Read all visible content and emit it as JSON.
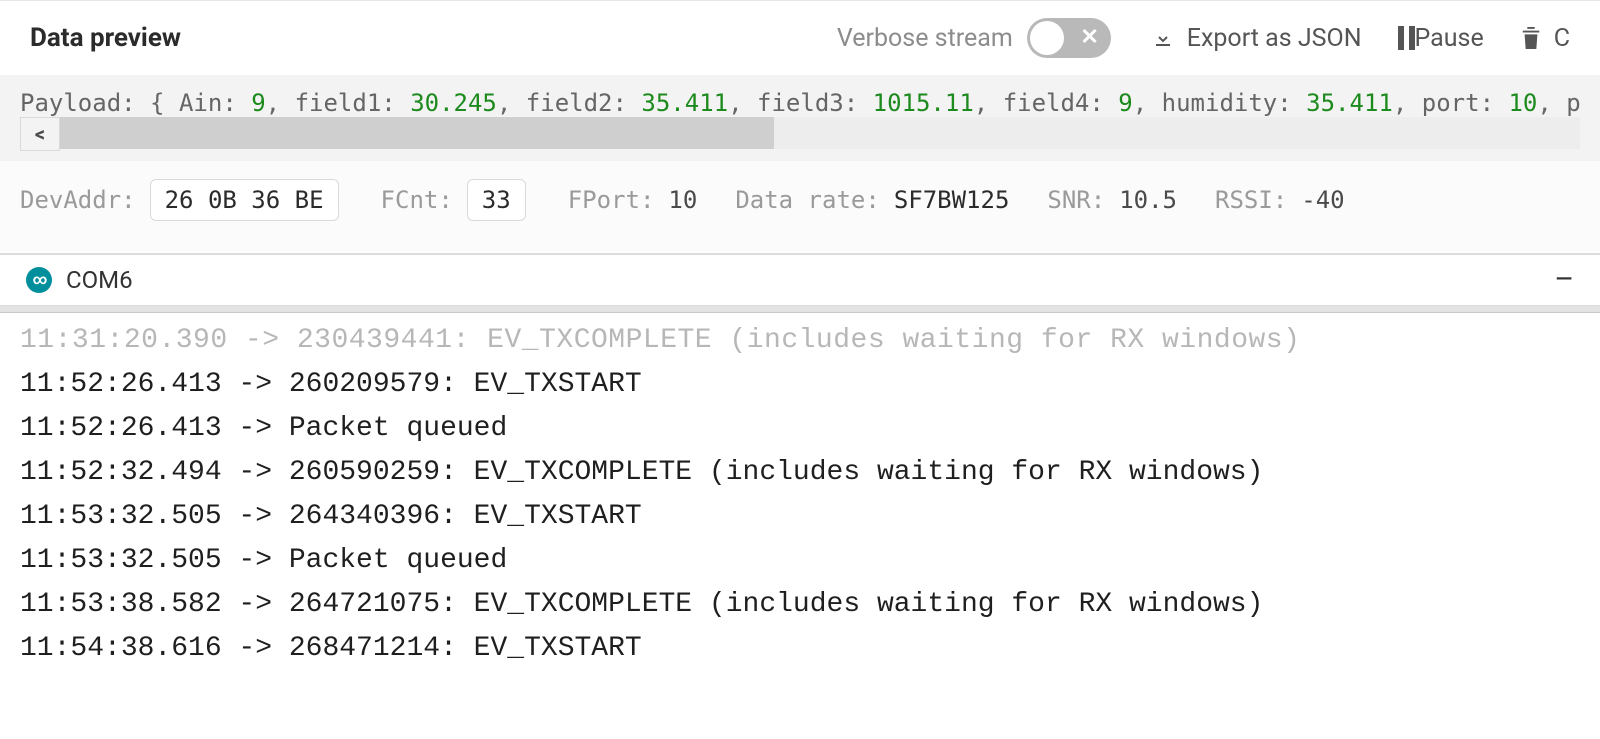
{
  "header": {
    "title": "Data preview",
    "verbose_label": "Verbose stream",
    "verbose_on": false,
    "actions": {
      "export": "Export as JSON",
      "pause": "Pause",
      "clear": "C"
    }
  },
  "payload": {
    "prefix": "Payload: ",
    "brace_open": "{ ",
    "pairs": [
      {
        "k": "Ain",
        "v": "9"
      },
      {
        "k": "field1",
        "v": "30.245"
      },
      {
        "k": "field2",
        "v": "35.411"
      },
      {
        "k": "field3",
        "v": "1015.11"
      },
      {
        "k": "field4",
        "v": "9"
      },
      {
        "k": "humidity",
        "v": "35.411"
      },
      {
        "k": "port",
        "v": "10"
      }
    ],
    "trailing": ", p"
  },
  "scrollbar": {
    "thumb_pct": 47
  },
  "meta": {
    "DevAddr": "26 0B 36 BE",
    "FCnt": "33",
    "FPort": "10",
    "DataRate": "SF7BW125",
    "SNR": "10.5",
    "RSSI": "-40"
  },
  "serial": {
    "port": "COM6",
    "cutoff": "11:31:20.390 -> 230439441: EV_TXCOMPLETE (includes waiting for RX windows)",
    "lines": [
      "11:52:26.413 -> 260209579: EV_TXSTART",
      "11:52:26.413 -> Packet queued",
      "11:52:32.494 -> 260590259: EV_TXCOMPLETE (includes waiting for RX windows)",
      "11:53:32.505 -> 264340396: EV_TXSTART",
      "11:53:32.505 -> Packet queued",
      "11:53:38.582 -> 264721075: EV_TXCOMPLETE (includes waiting for RX windows)",
      "11:54:38.616 -> 268471214: EV_TXSTART"
    ]
  },
  "labels": {
    "DevAddr": "DevAddr:",
    "FCnt": "FCnt:",
    "FPort": "FPort:",
    "DataRate": "Data rate:",
    "SNR": "SNR:",
    "RSSI": "RSSI:"
  }
}
